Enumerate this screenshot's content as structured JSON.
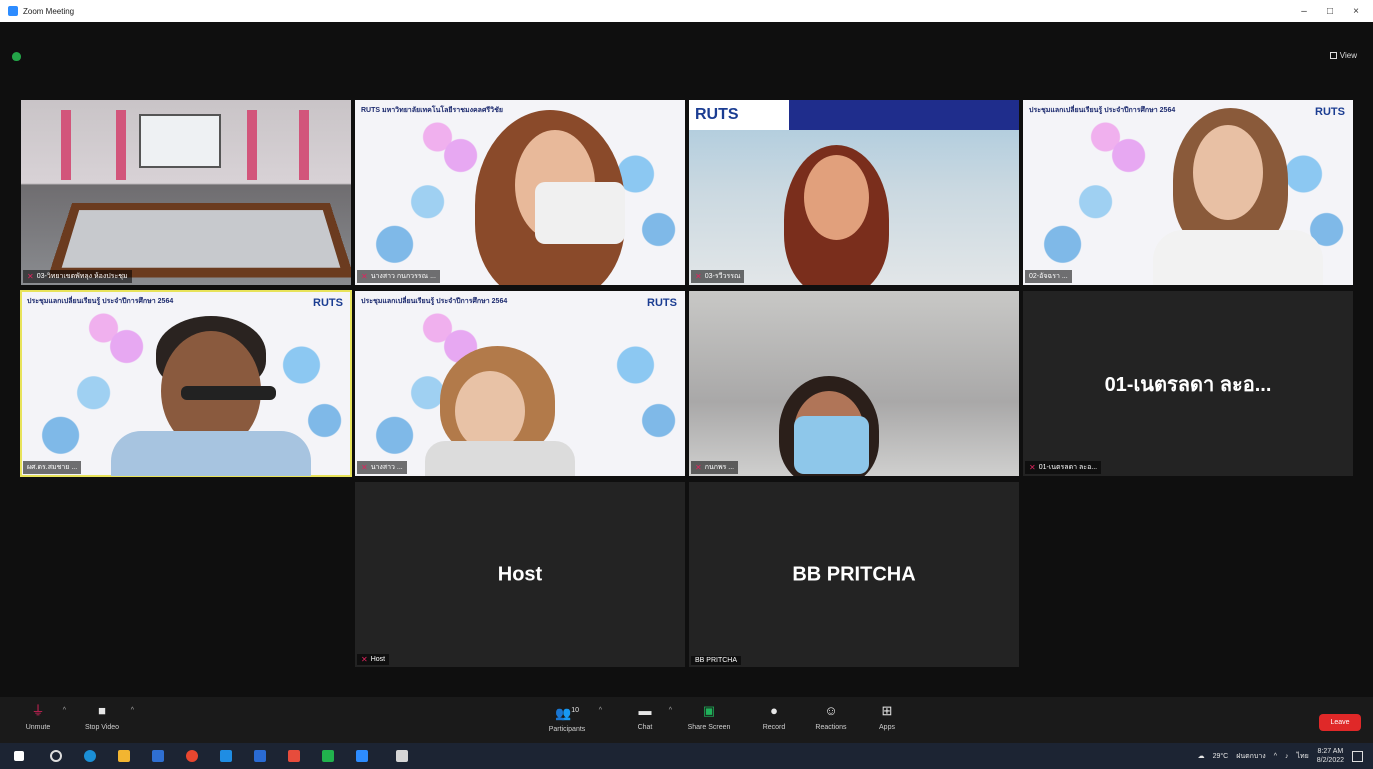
{
  "window": {
    "title": "Zoom Meeting",
    "controls": [
      "–",
      "□",
      "×"
    ]
  },
  "view_button": {
    "label": "View"
  },
  "tiles": [
    {
      "name": "03-วิทยาเขตพัทลุง ห้องประชุม",
      "kind": "video",
      "scene": "room",
      "active": false,
      "muted": true
    },
    {
      "name": "นางสาว กนกวรรณ ...",
      "kind": "video",
      "scene": "banner-mask",
      "active": false,
      "muted": true,
      "banner": "RUTS มหาวิทยาลัยเทคโนโลยีราชมงคลศรีวิชัย"
    },
    {
      "name": "03-รวีวรรณ",
      "kind": "video",
      "scene": "map",
      "active": false,
      "muted": true,
      "banner": "RUTS"
    },
    {
      "name": "02-อัจฉรา ...",
      "kind": "video",
      "scene": "banner-woman",
      "active": false,
      "muted": false,
      "banner": "ประชุมแลกเปลี่ยนเรียนรู้ ประจำปีการศึกษา 2564"
    },
    {
      "name": "ผศ.ดร.สมชาย ...",
      "kind": "video",
      "scene": "banner-man",
      "active": true,
      "muted": false,
      "banner": "ประชุมแลกเปลี่ยนเรียนรู้ ประจำปีการศึกษา 2564"
    },
    {
      "name": "นางสาว ...",
      "kind": "video",
      "scene": "banner-woman2",
      "active": false,
      "muted": true,
      "banner": "ประชุมแลกเปลี่ยนเรียนรู้ ประจำปีการศึกษา 2564"
    },
    {
      "name": "กนกพร ...",
      "kind": "video",
      "scene": "mask-woman",
      "active": false,
      "muted": true
    },
    {
      "name": "01-เนตรลดา ละอ...",
      "kind": "name",
      "display": "01-เนตรลดา ละอ...",
      "active": false,
      "muted": true
    },
    {
      "name": "Host",
      "kind": "name",
      "display": "Host",
      "active": false,
      "muted": true
    },
    {
      "name": "BB PRITCHA",
      "kind": "name",
      "display": "BB PRITCHA",
      "active": false,
      "muted": false
    }
  ],
  "toolbar": {
    "unmute": {
      "label": "Unmute",
      "icon": "microphone-muted-icon"
    },
    "start_video": {
      "label": "Stop Video",
      "icon": "video-camera-icon"
    },
    "participants": {
      "label": "Participants",
      "count": "10",
      "icon": "participants-icon"
    },
    "chat": {
      "label": "Chat",
      "icon": "chat-icon"
    },
    "share": {
      "label": "Share Screen",
      "icon": "share-screen-icon"
    },
    "record": {
      "label": "Record",
      "icon": "record-icon"
    },
    "reactions": {
      "label": "Reactions",
      "icon": "reactions-icon"
    },
    "apps": {
      "label": "Apps",
      "icon": "apps-icon"
    },
    "leave": {
      "label": "Leave"
    }
  },
  "taskbar": {
    "weather": "29°C",
    "weather_desc": "ฝนตกบาง",
    "lang": "ไทย",
    "time": "8:27 AM",
    "date": "8/2/2022"
  }
}
